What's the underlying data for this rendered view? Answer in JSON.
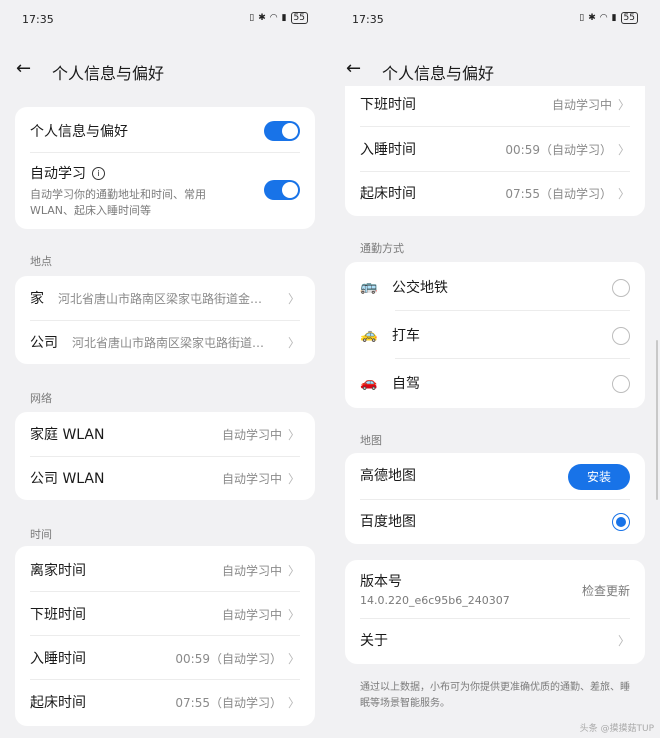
{
  "status": {
    "time": "17:35",
    "battery": "55"
  },
  "header": {
    "title": "个人信息与偏好"
  },
  "left": {
    "main_toggle_label": "个人信息与偏好",
    "auto_learn_label": "自动学习",
    "auto_learn_desc": "自动学习你的通勤地址和时间、常用WLAN、起床入睡时间等",
    "sections": {
      "location": "地点",
      "network": "网络",
      "time": "时间"
    },
    "locations": [
      {
        "label": "家",
        "value": "河北省唐山市路南区梁家屯路街道金…"
      },
      {
        "label": "公司",
        "value": "河北省唐山市路南区梁家屯路街道…"
      }
    ],
    "networks": [
      {
        "label": "家庭 WLAN",
        "value": "自动学习中"
      },
      {
        "label": "公司 WLAN",
        "value": "自动学习中"
      }
    ],
    "times": [
      {
        "label": "离家时间",
        "value": "自动学习中"
      },
      {
        "label": "下班时间",
        "value": "自动学习中"
      },
      {
        "label": "入睡时间",
        "value": "00:59（自动学习）"
      },
      {
        "label": "起床时间",
        "value": "07:55（自动学习）"
      }
    ]
  },
  "right": {
    "times": [
      {
        "label": "下班时间",
        "value": "自动学习中"
      },
      {
        "label": "入睡时间",
        "value": "00:59（自动学习）"
      },
      {
        "label": "起床时间",
        "value": "07:55（自动学习）"
      }
    ],
    "commute_section": "通勤方式",
    "commute": [
      {
        "label": "公交地铁",
        "icon": "bus-icon",
        "selected": false
      },
      {
        "label": "打车",
        "icon": "taxi-icon",
        "selected": false
      },
      {
        "label": "自驾",
        "icon": "car-icon",
        "selected": false
      }
    ],
    "map_section": "地图",
    "maps": [
      {
        "label": "高德地图",
        "action": "安装"
      },
      {
        "label": "百度地图",
        "selected": true
      }
    ],
    "version_label": "版本号",
    "version_value": "14.0.220_e6c95b6_240307",
    "check_update": "检查更新",
    "about_label": "关于",
    "footer": "通过以上数据，小布可为你提供更准确优质的通勤、差旅、睡眠等场景智能服务。"
  },
  "watermark": "头条 @摸摸菇TUP",
  "colors": {
    "accent": "#1873e8",
    "background": "#f1f1f3",
    "card": "#ffffff"
  }
}
